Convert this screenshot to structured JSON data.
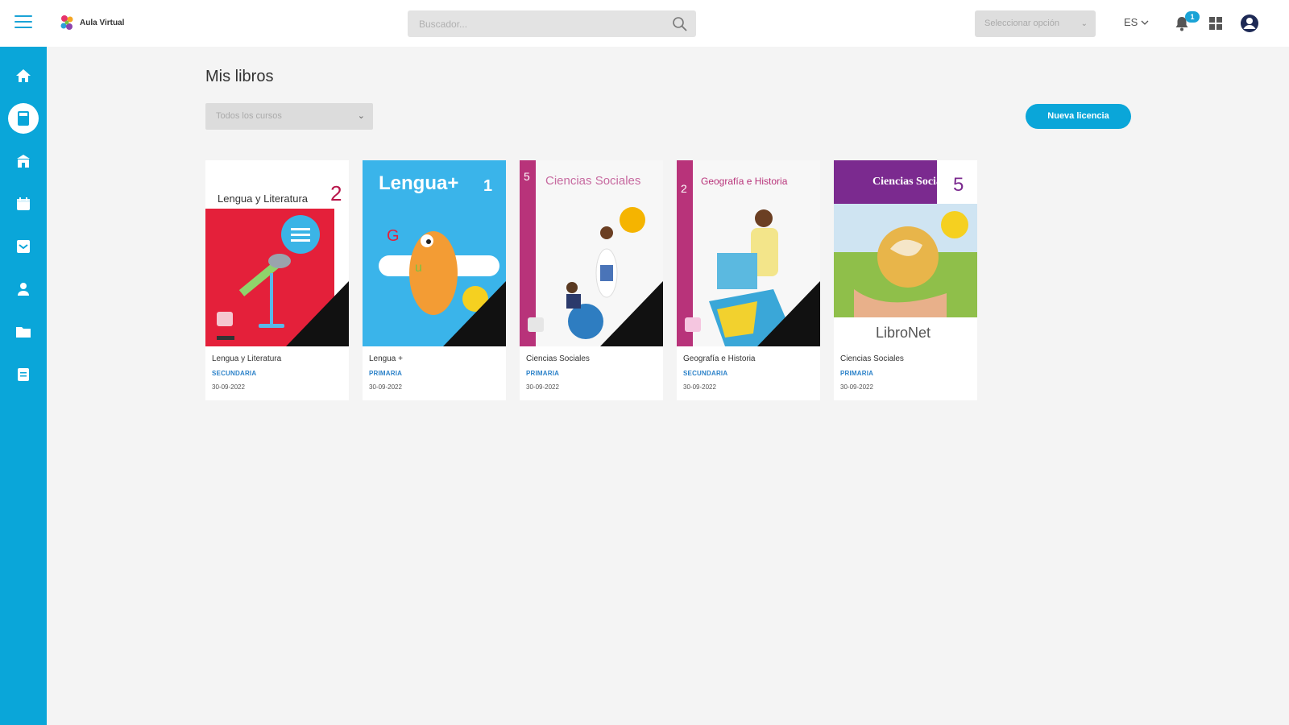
{
  "app": {
    "name": "Aula Virtual"
  },
  "header": {
    "search_placeholder": "Buscador...",
    "select_label": "Seleccionar opción",
    "language": "ES",
    "notifications_count": "1"
  },
  "sidebar": {
    "items": [
      {
        "icon": "home-icon"
      },
      {
        "icon": "book-icon",
        "active": true
      },
      {
        "icon": "school-icon"
      },
      {
        "icon": "calendar-icon"
      },
      {
        "icon": "inbox-icon"
      },
      {
        "icon": "person-icon"
      },
      {
        "icon": "folder-icon"
      },
      {
        "icon": "document-icon"
      }
    ]
  },
  "main": {
    "title": "Mis libros",
    "course_filter": "Todos los cursos",
    "new_license_label": "Nueva licencia",
    "books": [
      {
        "title": "Lengua y Literatura",
        "level": "SECUNDARIA",
        "date": "30-09-2022",
        "cover_title": "Lengua y Literatura",
        "cover_number": "2"
      },
      {
        "title": "Lengua +",
        "level": "PRIMARIA",
        "date": "30-09-2022",
        "cover_title": "Lengua+",
        "cover_number": "1"
      },
      {
        "title": "Ciencias Sociales",
        "level": "PRIMARIA",
        "date": "30-09-2022",
        "cover_title": "Ciencias Sociales",
        "cover_number": "5"
      },
      {
        "title": "Geografía e Historia",
        "level": "SECUNDARIA",
        "date": "30-09-2022",
        "cover_title": "Geografía e Historia",
        "cover_number": "2"
      },
      {
        "title": "Ciencias Sociales",
        "level": "PRIMARIA",
        "date": "30-09-2022",
        "cover_title": "Ciencias Sociales",
        "cover_number": "5",
        "cover_brand": "LibroNet"
      }
    ]
  },
  "colors": {
    "accent": "#0aa6d9",
    "level_text": "#2c82c9"
  }
}
